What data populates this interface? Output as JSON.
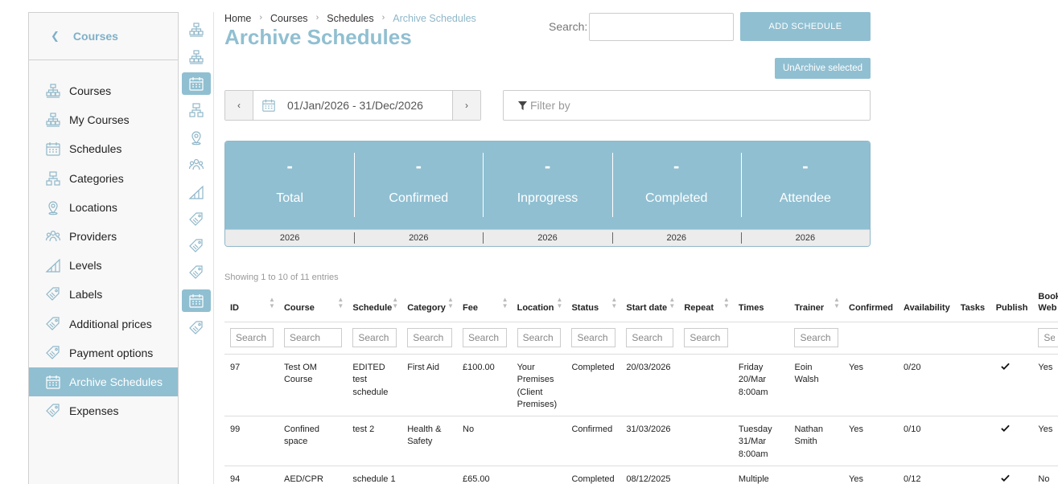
{
  "sidebar": {
    "back_label": "Courses",
    "items": [
      {
        "label": "Courses",
        "icon": "sitemap-icon"
      },
      {
        "label": "My Courses",
        "icon": "sitemap-icon"
      },
      {
        "label": "Schedules",
        "icon": "calendar-icon"
      },
      {
        "label": "Categories",
        "icon": "hierarchy-icon"
      },
      {
        "label": "Locations",
        "icon": "location-pin-icon"
      },
      {
        "label": "Providers",
        "icon": "people-icon"
      },
      {
        "label": "Levels",
        "icon": "levels-icon"
      },
      {
        "label": "Labels",
        "icon": "tag-icon"
      },
      {
        "label": "Additional prices",
        "icon": "tag-icon"
      },
      {
        "label": "Payment options",
        "icon": "tag-icon"
      },
      {
        "label": "Archive Schedules",
        "icon": "calendar-icon",
        "active": true
      },
      {
        "label": "Expenses",
        "icon": "tag-icon"
      }
    ]
  },
  "breadcrumb": [
    "Home",
    "Courses",
    "Schedules",
    "Archive Schedules"
  ],
  "page_title": "Archive Schedules",
  "search": {
    "label": "Search:",
    "value": ""
  },
  "add_button": "ADD SCHEDULE",
  "unarchive_button": "UnArchive selected",
  "daterange": {
    "text": "01/Jan/2026 - 31/Dec/2026",
    "prev": "‹",
    "next": "›"
  },
  "filter": {
    "placeholder": "Filter by"
  },
  "stats": [
    {
      "value": "-",
      "label": "Total",
      "year": "2026"
    },
    {
      "value": "-",
      "label": "Confirmed",
      "year": "2026"
    },
    {
      "value": "-",
      "label": "Inprogress",
      "year": "2026"
    },
    {
      "value": "-",
      "label": "Completed",
      "year": "2026"
    },
    {
      "value": "-",
      "label": "Attendee",
      "year": "2026"
    }
  ],
  "entries_text": "Showing 1 to 10 of 11 entries",
  "table": {
    "search_placeholder": "Search",
    "columns": [
      "ID",
      "Course",
      "Schedule",
      "Category",
      "Fee",
      "Location",
      "Status",
      "Start date",
      "Repeat",
      "Times",
      "Trainer",
      "Confirmed",
      "Availability",
      "Tasks",
      "Publish",
      "Book Web"
    ],
    "rows": [
      {
        "id": "97",
        "course": "Test OM Course",
        "schedule": "EDITED test schedule",
        "category": "First Aid",
        "fee": "£100.00",
        "location": "Your Premises (Client Premises)",
        "status": "Completed",
        "start": "20/03/2026",
        "repeat": "",
        "times": "Friday 20/Mar 8:00am",
        "trainer": "Eoin Walsh",
        "confirmed": "Yes",
        "availability": "0/20",
        "tasks": "",
        "book_web": "Yes"
      },
      {
        "id": "99",
        "course": "Confined space",
        "schedule": "test 2",
        "category": "Health & Safety",
        "fee": "No",
        "location": "",
        "status": "Confirmed",
        "start": "31/03/2026",
        "repeat": "",
        "times": "Tuesday 31/Mar 8:00am",
        "trainer": "Nathan Smith",
        "confirmed": "Yes",
        "availability": "0/10",
        "tasks": "",
        "book_web": "Yes"
      },
      {
        "id": "94",
        "course": "AED/CPR Plus",
        "schedule": "schedule 1",
        "category": "",
        "fee": "£65.00",
        "location": "",
        "status": "Completed",
        "start": "08/12/2025",
        "repeat": "",
        "times": "Multiple",
        "trainer": "",
        "confirmed": "Yes",
        "availability": "0/12",
        "tasks": "",
        "book_web": "No"
      }
    ]
  }
}
